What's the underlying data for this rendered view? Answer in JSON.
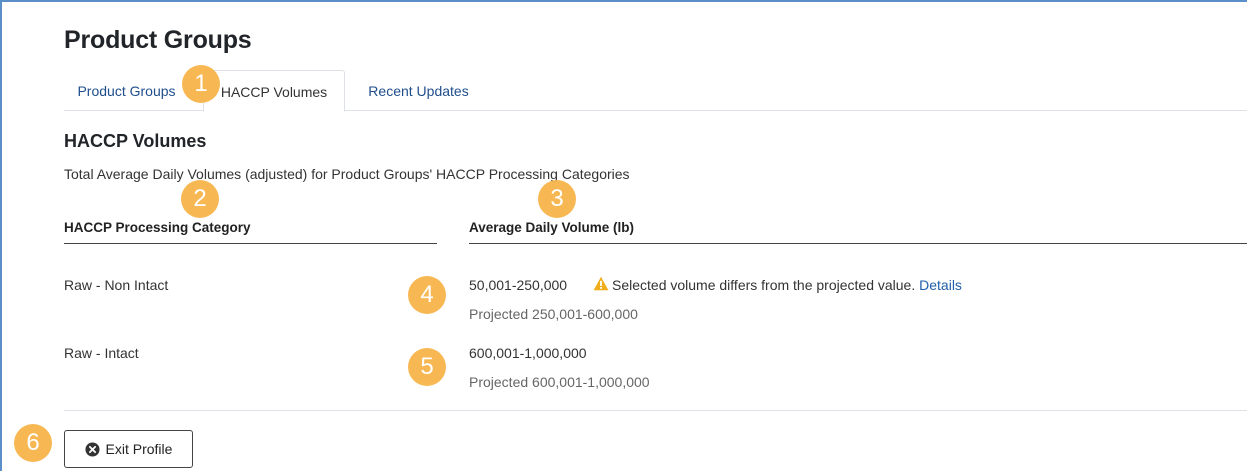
{
  "page": {
    "title": "Product Groups"
  },
  "tabs": [
    {
      "label": "Product Groups",
      "active": false
    },
    {
      "label": "HACCP Volumes",
      "active": true
    },
    {
      "label": "Recent Updates",
      "active": false
    }
  ],
  "section": {
    "title": "HACCP Volumes",
    "description": "Total Average Daily Volumes (adjusted) for Product Groups' HACCP Processing Categories"
  },
  "table": {
    "headers": [
      "HACCP Processing Category",
      "Average Daily Volume (lb)"
    ],
    "rows": [
      {
        "category": "Raw - Non Intact",
        "volume": "50,001-250,000",
        "warning": "Selected volume differs from the projected value.",
        "details_label": "Details",
        "projected": "Projected 250,001-600,000"
      },
      {
        "category": "Raw - Intact",
        "volume": "600,001-1,000,000",
        "projected": "Projected 600,001-1,000,000"
      }
    ]
  },
  "actions": {
    "exit_label": "Exit Profile"
  },
  "markers": [
    "1",
    "2",
    "3",
    "4",
    "5",
    "6"
  ],
  "colors": {
    "link": "#1f5fa8",
    "tab_link": "#1f4e8c",
    "warning_icon": "#f0ad1c",
    "marker": "#f7b54a",
    "frame_border": "#5b8fc7"
  },
  "icons": {
    "warning": "warning-triangle-icon",
    "exit": "times-circle-icon"
  }
}
